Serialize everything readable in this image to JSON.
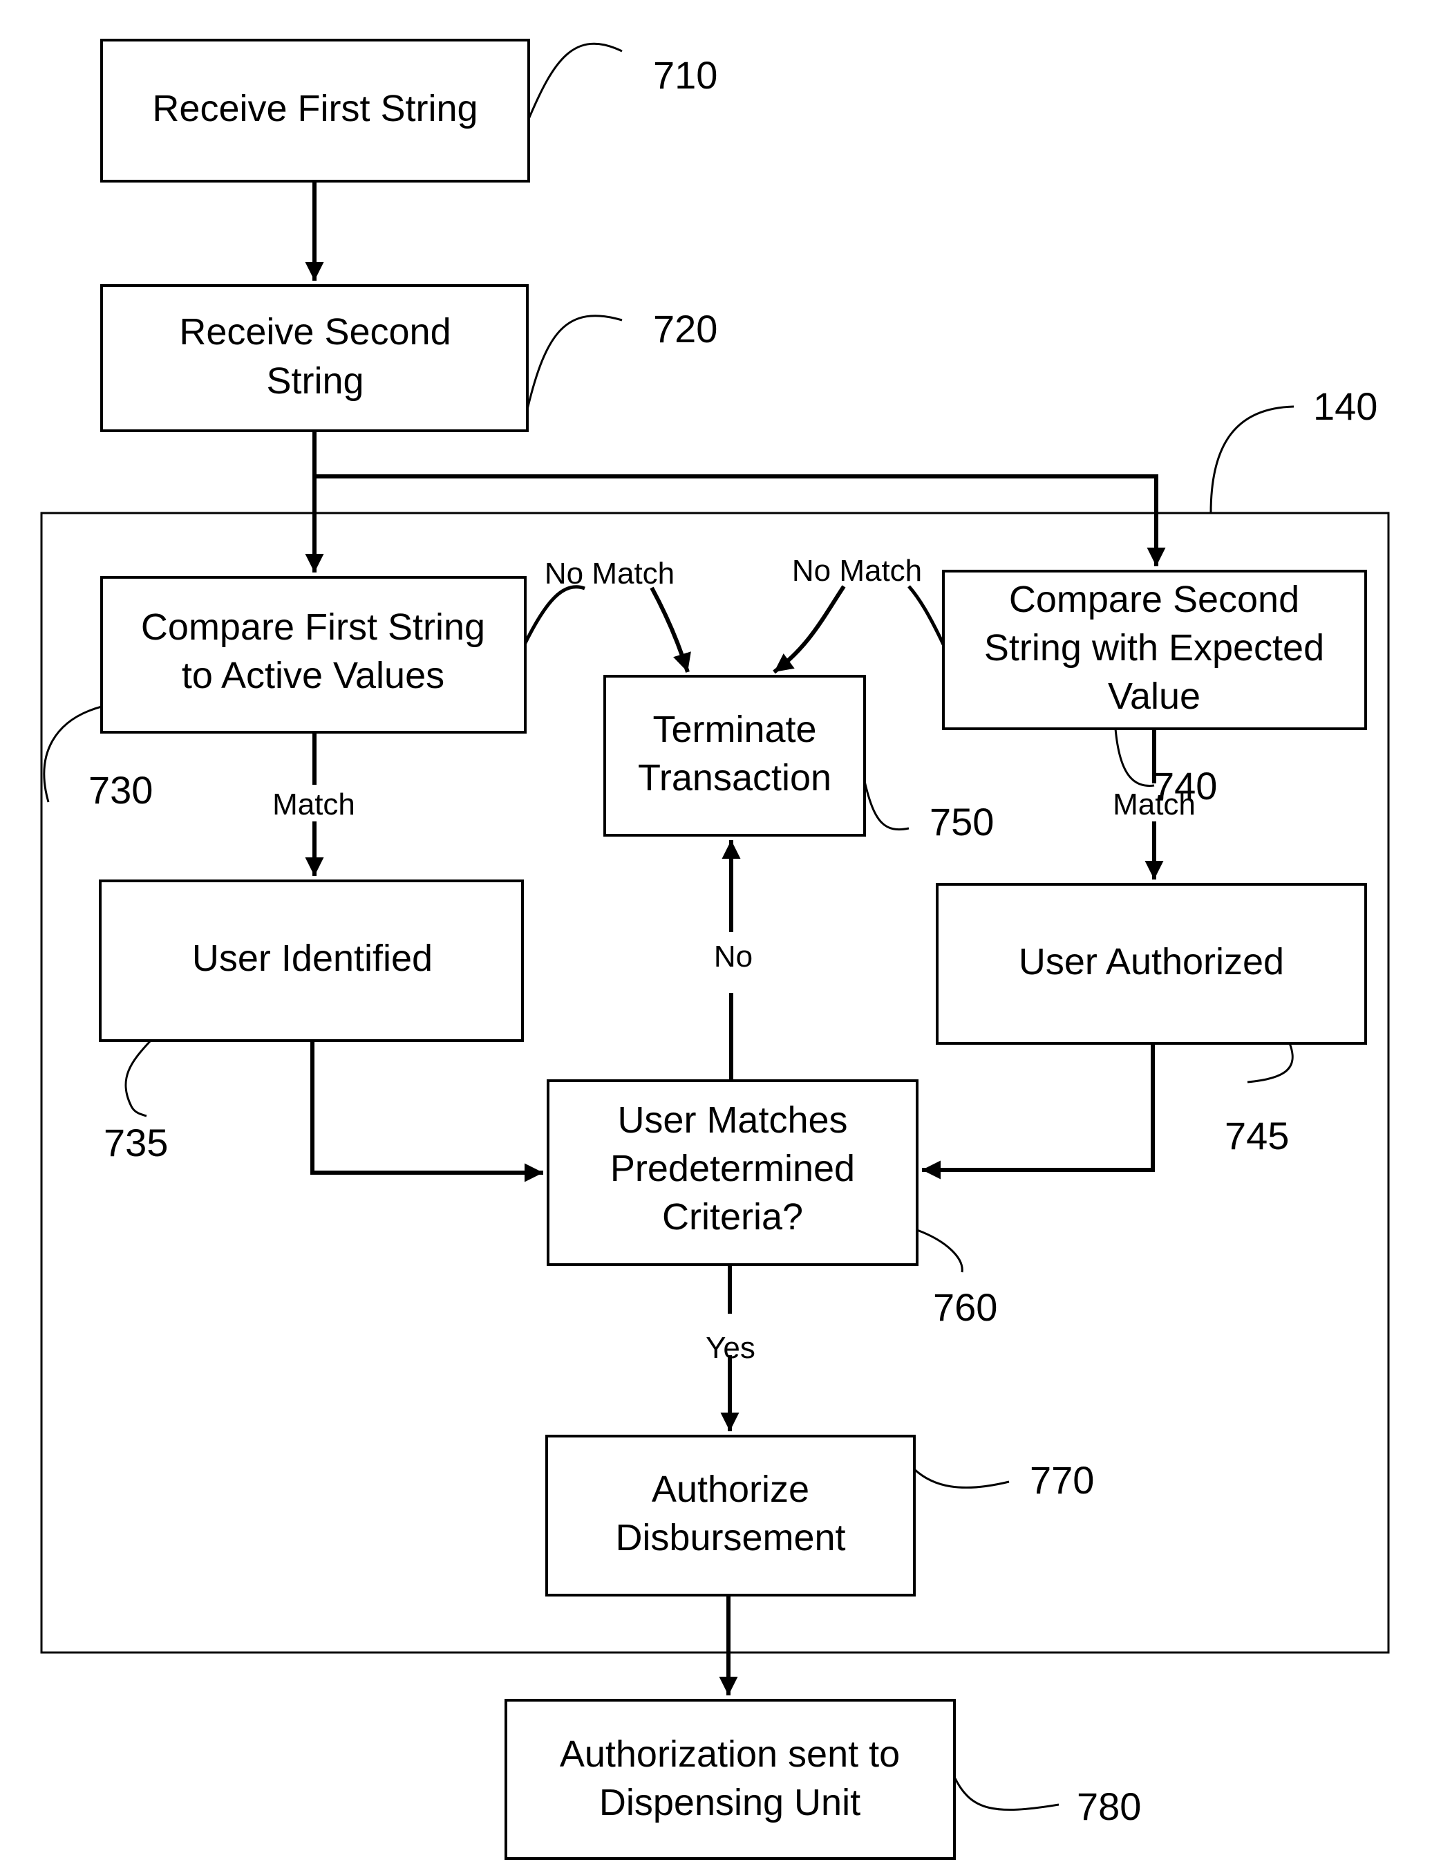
{
  "figure": {
    "container_ref": "140",
    "steps": {
      "s710": {
        "ref": "710",
        "lines": [
          "Receive First String"
        ]
      },
      "s720": {
        "ref": "720",
        "lines": [
          "Receive Second",
          "String"
        ]
      },
      "s730": {
        "ref": "730",
        "lines": [
          "Compare First String",
          "to Active Values"
        ]
      },
      "s740": {
        "ref": "740",
        "lines": [
          "Compare Second",
          "String with Expected",
          "Value"
        ]
      },
      "s750": {
        "ref": "750",
        "lines": [
          "Terminate",
          "Transaction"
        ]
      },
      "s735": {
        "ref": "735",
        "lines": [
          "User Identified"
        ]
      },
      "s745": {
        "ref": "745",
        "lines": [
          "User Authorized"
        ]
      },
      "s760": {
        "ref": "760",
        "lines": [
          "User Matches",
          "Predetermined",
          "Criteria?"
        ]
      },
      "s770": {
        "ref": "770",
        "lines": [
          "Authorize",
          "Disbursement"
        ]
      },
      "s780": {
        "ref": "780",
        "lines": [
          "Authorization sent to",
          "Dispensing Unit"
        ]
      }
    },
    "edge_labels": {
      "no_match_left": "No Match",
      "no_match_right": "No Match",
      "match_left": "Match",
      "match_right": "Match",
      "no": "No",
      "yes": "Yes"
    }
  }
}
